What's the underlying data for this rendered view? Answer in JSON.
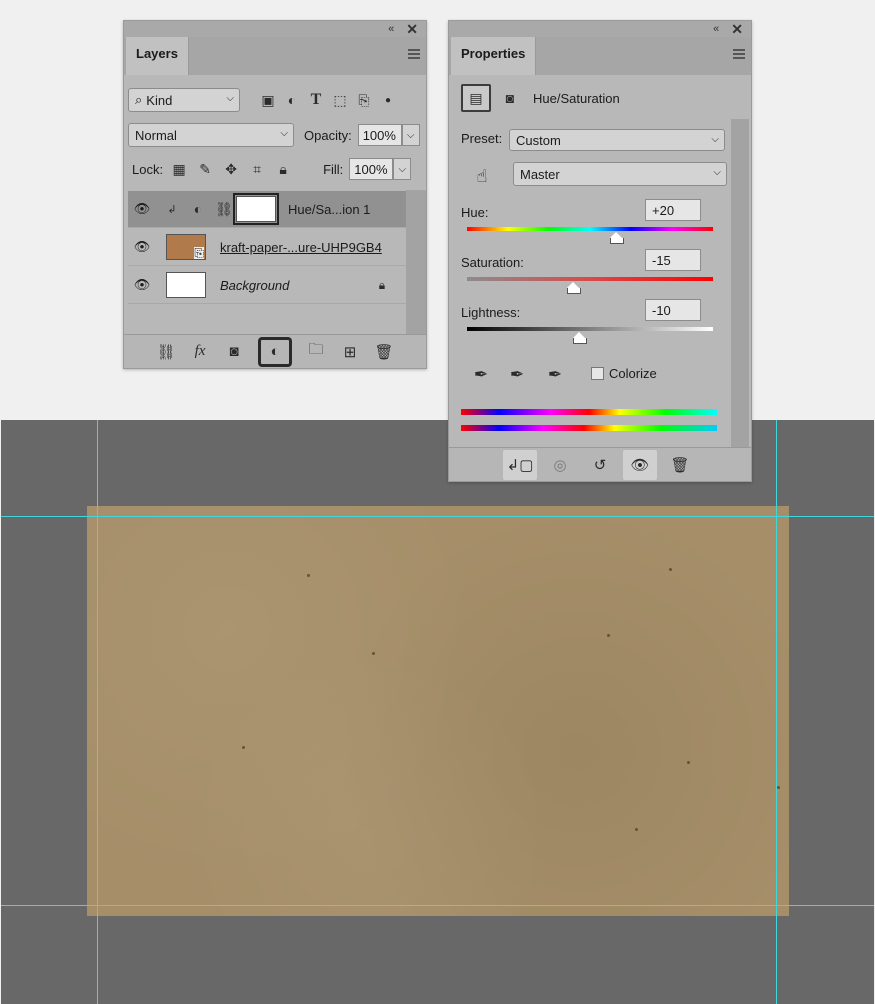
{
  "layers_panel": {
    "tab": "Layers",
    "filter": "Kind",
    "blend_mode": "Normal",
    "opacity_label": "Opacity:",
    "opacity_value": "100%",
    "lock_label": "Lock:",
    "fill_label": "Fill:",
    "fill_value": "100%",
    "layers": [
      {
        "name": "Hue/Sa...ion 1",
        "selected": true,
        "type": "adjustment"
      },
      {
        "name": "kraft-paper-...ure-UHP9GB4",
        "selected": false,
        "type": "smart-object"
      },
      {
        "name": "Background",
        "selected": false,
        "type": "background",
        "locked": true
      }
    ]
  },
  "properties_panel": {
    "tab": "Properties",
    "adjustment_title": "Hue/Saturation",
    "preset_label": "Preset:",
    "preset_value": "Custom",
    "channel_value": "Master",
    "hue_label": "Hue:",
    "hue_value": "+20",
    "saturation_label": "Saturation:",
    "saturation_value": "-15",
    "lightness_label": "Lightness:",
    "lightness_value": "-10",
    "colorize_label": "Colorize",
    "colorize_checked": false
  },
  "colors": {
    "canvas_bg": "#686868",
    "paper": "#a58e68",
    "guide": "#3fd6dc",
    "panel": "#b8b8b8"
  }
}
